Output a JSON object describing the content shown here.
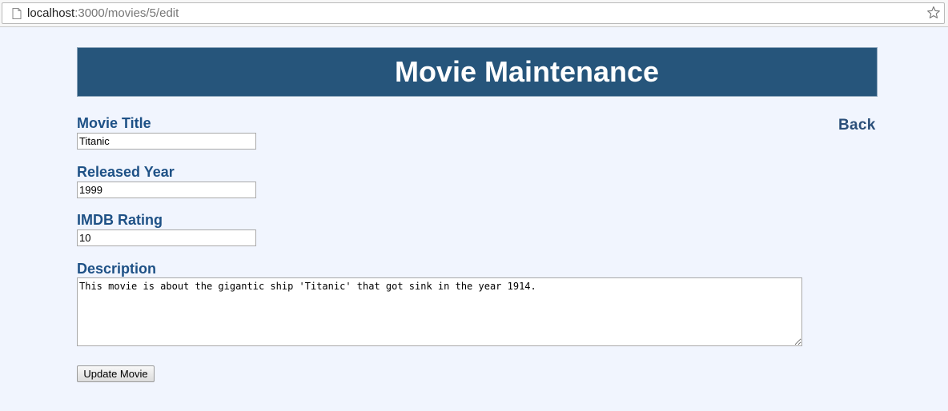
{
  "browser": {
    "url_host": "localhost",
    "url_path": ":3000/movies/5/edit",
    "page_icon": "page-icon",
    "bookmark_icon": "star-icon"
  },
  "header": {
    "title": "Movie Maintenance",
    "background_color": "#26557b"
  },
  "nav": {
    "back_label": "Back"
  },
  "form": {
    "title_label": "Movie Title",
    "title_value": "Titanic",
    "year_label": "Released Year",
    "year_value": "1999",
    "rating_label": "IMDB Rating",
    "rating_value": "10",
    "description_label": "Description",
    "description_value": "This movie is about the gigantic ship 'Titanic' that got sink in the year 1914.",
    "submit_label": "Update Movie"
  },
  "colors": {
    "label_color": "#1e5186",
    "page_background": "#f1f5fe"
  }
}
